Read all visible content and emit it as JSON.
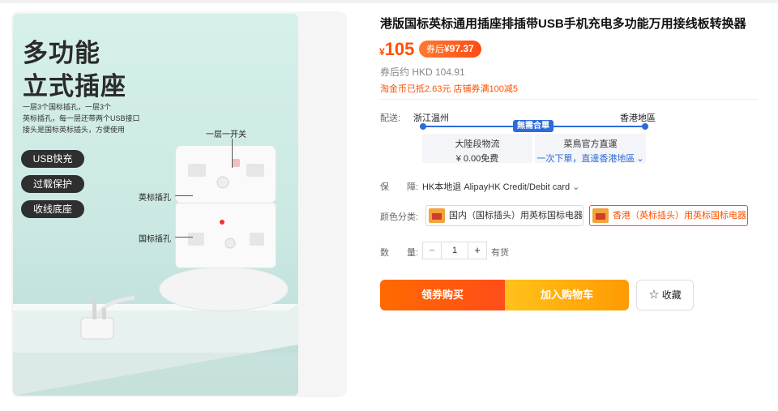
{
  "product": {
    "title": "港版国标英标通用插座排插带USB手机充电多功能万用接线板转换器",
    "currency_symbol": "¥",
    "price": "105",
    "coupon_label": "券后",
    "coupon_price": "¥97.37",
    "hkd_estimate": "券后约 HKD 104.91",
    "promo_text": "淘金币已抵2.63元 店铺券满100减5"
  },
  "image": {
    "title_line1": "多功能",
    "title_line2": "立式插座",
    "description": "一层3个国标插孔，一层3个\n英标插孔，每一层还带两个USB接口\n接头是国标英标插头，方便使用",
    "tags": [
      "USB快充",
      "过载保护",
      "收线底座"
    ],
    "callout_switch": "一层一开关",
    "callout_uk": "英标插孔",
    "callout_cn": "国标插孔"
  },
  "shipping": {
    "label": "配送:",
    "from": "浙江温州",
    "to": "香港地區",
    "badge": "無需合單",
    "method_title": "大陸段物流",
    "method_fee": "¥ 0.00免费",
    "service_title": "菜鳥官方直運",
    "service_link": "一次下單，直達香港地區",
    "chevron_icon": "chevron-down-icon"
  },
  "guarantee": {
    "label": "保　　障:",
    "value": "HK本地退 AlipayHK Credit/Debit card"
  },
  "options": {
    "label": "颜色分类:",
    "items": [
      {
        "label": "国内（国标插头）用英标国标电器",
        "selected": false
      },
      {
        "label": "香港（英标插头）用英标国标电器",
        "selected": true
      }
    ],
    "accent_color": "#ff5000"
  },
  "quantity": {
    "label": "数　　量:",
    "minus": "−",
    "value": "1",
    "plus": "+",
    "stock": "有货"
  },
  "actions": {
    "buy_label": "领券购买",
    "cart_label": "加入购物车",
    "fav_label": "收藏",
    "fav_icon": "star-icon"
  }
}
